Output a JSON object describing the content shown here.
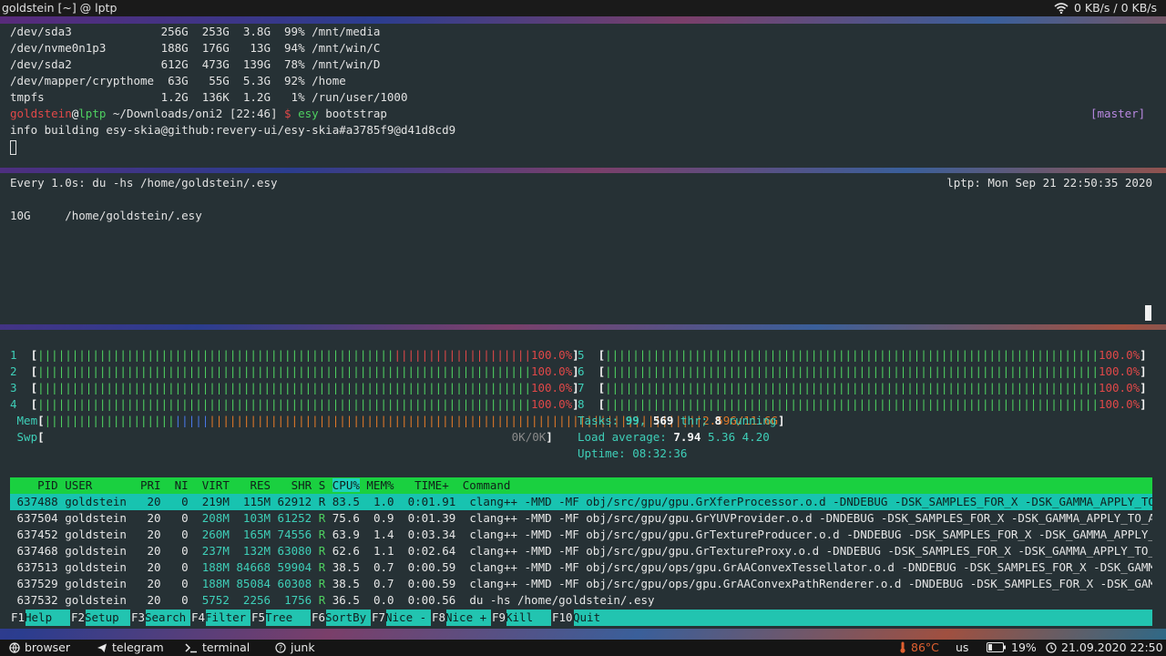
{
  "topbar": {
    "window_title": "goldstein [~] @ lptp",
    "net_rate": "0 KB/s / 0 KB/s"
  },
  "terminal1": {
    "df_rows": [
      "/dev/sda3             256G  253G  3.8G  99% /mnt/media",
      "/dev/nvme0n1p3        188G  176G   13G  94% /mnt/win/C",
      "/dev/sda2             612G  473G  139G  78% /mnt/win/D",
      "/dev/mapper/crypthome  63G   55G  5.3G  92% /home",
      "tmpfs                 1.2G  136K  1.2G   1% /run/user/1000"
    ],
    "prompt": {
      "user": "goldstein",
      "at": "@",
      "host": "lptp",
      "path": " ~/Downloads/oni2 [22:46] ",
      "dollar": "$ ",
      "cmd": "esy",
      "args": " bootstrap",
      "branch": "[master]"
    },
    "info_line": "info building esy-skia@github:revery-ui/esy-skia#a3785f9@d41d8cd9"
  },
  "terminal2": {
    "watch_header": "Every 1.0s: du -hs /home/goldstein/.esy",
    "watch_host_time": "lptp: Mon Sep 21 22:50:35 2020",
    "output": "10G     /home/goldstein/.esy"
  },
  "htop": {
    "cpus_left": [
      {
        "num": "1",
        "pct": "100.0%"
      },
      {
        "num": "2",
        "pct": "100.0%"
      },
      {
        "num": "3",
        "pct": "100.0%"
      },
      {
        "num": "4",
        "pct": "100.0%"
      }
    ],
    "cpus_right": [
      {
        "num": "5",
        "pct": "100.0%"
      },
      {
        "num": "6",
        "pct": "100.0%"
      },
      {
        "num": "7",
        "pct": "100.0%"
      },
      {
        "num": "8",
        "pct": "100.0%"
      }
    ],
    "mem_label": "Mem",
    "mem_value": "2.59G/11.6G",
    "swp_label": "Swp",
    "swp_value": "0K/0K",
    "tasks_label": "Tasks: ",
    "tasks_count": "99",
    "thr_count": "569",
    "thr_label": " thr; ",
    "running_count": "8",
    "running_label": " running",
    "load_label": "Load average: ",
    "load_1": "7.94",
    "load_5": "5.36",
    "load_15": "4.20",
    "uptime_label": "Uptime: ",
    "uptime": "08:32:36",
    "columns": {
      "pid": "    PID",
      "user": " USER      ",
      "pri": " PRI ",
      "ni": " NI ",
      "virt": " VIRT ",
      "res": "  RES ",
      "shr": "  SHR ",
      "s": "S ",
      "cpu": "CPU%",
      "mem": " MEM%",
      "time": "   TIME+ ",
      "command": " Command"
    },
    "processes": [
      {
        "pid": "637488",
        "user": "goldstein",
        "pri": "20",
        "ni": "0",
        "virt": "219M",
        "res": "115M",
        "shr": "62912",
        "s": "R",
        "cpu": "83.5",
        "mem": "1.0",
        "time": "0:01.91",
        "cmd": "clang++ -MMD -MF obj/src/gpu/gpu.GrXferProcessor.o.d -DNDEBUG -DSK_SAMPLES_FOR_X -DSK_GAMMA_APPLY_TO_A8 -D"
      },
      {
        "pid": "637504",
        "user": "goldstein",
        "pri": "20",
        "ni": "0",
        "virt": "208M",
        "res": "103M",
        "shr": "61252",
        "s": "R",
        "cpu": "75.6",
        "mem": "0.9",
        "time": "0:01.39",
        "cmd": "clang++ -MMD -MF obj/src/gpu/gpu.GrYUVProvider.o.d -DNDEBUG -DSK_SAMPLES_FOR_X -DSK_GAMMA_APPLY_TO_A8 -DSK"
      },
      {
        "pid": "637452",
        "user": "goldstein",
        "pri": "20",
        "ni": "0",
        "virt": "260M",
        "res": "165M",
        "shr": "74556",
        "s": "R",
        "cpu": "63.9",
        "mem": "1.4",
        "time": "0:03.34",
        "cmd": "clang++ -MMD -MF obj/src/gpu/gpu.GrTextureProducer.o.d -DNDEBUG -DSK_SAMPLES_FOR_X -DSK_GAMMA_APPLY_TO_A8"
      },
      {
        "pid": "637468",
        "user": "goldstein",
        "pri": "20",
        "ni": "0",
        "virt": "237M",
        "res": "132M",
        "shr": "63080",
        "s": "R",
        "cpu": "62.6",
        "mem": "1.1",
        "time": "0:02.64",
        "cmd": "clang++ -MMD -MF obj/src/gpu/gpu.GrTextureProxy.o.d -DNDEBUG -DSK_SAMPLES_FOR_X -DSK_GAMMA_APPLY_TO_A8 -DS"
      },
      {
        "pid": "637513",
        "user": "goldstein",
        "pri": "20",
        "ni": "0",
        "virt": "188M",
        "res": "84668",
        "shr": "59904",
        "s": "R",
        "cpu": "38.5",
        "mem": "0.7",
        "time": "0:00.59",
        "cmd": "clang++ -MMD -MF obj/src/gpu/ops/gpu.GrAAConvexTessellator.o.d -DNDEBUG -DSK_SAMPLES_FOR_X -DSK_GAMMA_APPL"
      },
      {
        "pid": "637529",
        "user": "goldstein",
        "pri": "20",
        "ni": "0",
        "virt": "188M",
        "res": "85084",
        "shr": "60308",
        "s": "R",
        "cpu": "38.5",
        "mem": "0.7",
        "time": "0:00.59",
        "cmd": "clang++ -MMD -MF obj/src/gpu/ops/gpu.GrAAConvexPathRenderer.o.d -DNDEBUG -DSK_SAMPLES_FOR_X -DSK_GAMMA_APP"
      },
      {
        "pid": "637532",
        "user": "goldstein",
        "pri": "20",
        "ni": "0",
        "virt": "5752",
        "res": "2256",
        "shr": "1756",
        "s": "R",
        "cpu": "36.5",
        "mem": "0.0",
        "time": "0:00.56",
        "cmd": "du -hs /home/goldstein/.esy"
      }
    ],
    "fkeys": [
      {
        "key": "F1",
        "label": "Help"
      },
      {
        "key": "F2",
        "label": "Setup"
      },
      {
        "key": "F3",
        "label": "Search"
      },
      {
        "key": "F4",
        "label": "Filter"
      },
      {
        "key": "F5",
        "label": "Tree"
      },
      {
        "key": "F6",
        "label": "SortBy"
      },
      {
        "key": "F7",
        "label": "Nice -"
      },
      {
        "key": "F8",
        "label": "Nice +"
      },
      {
        "key": "F9",
        "label": "Kill"
      },
      {
        "key": "F10",
        "label": "Quit"
      }
    ]
  },
  "taskbar": {
    "items": [
      {
        "icon": "browser-icon",
        "label": "browser"
      },
      {
        "icon": "telegram-icon",
        "label": "telegram"
      },
      {
        "icon": "terminal-icon",
        "label": "terminal"
      },
      {
        "icon": "help-icon",
        "label": "junk"
      }
    ],
    "temperature": "86°C",
    "keyboard_layout": "us",
    "battery": "19%",
    "datetime": "21.09.2020 22:50",
    "colors": {
      "temp": "#e06030"
    }
  }
}
